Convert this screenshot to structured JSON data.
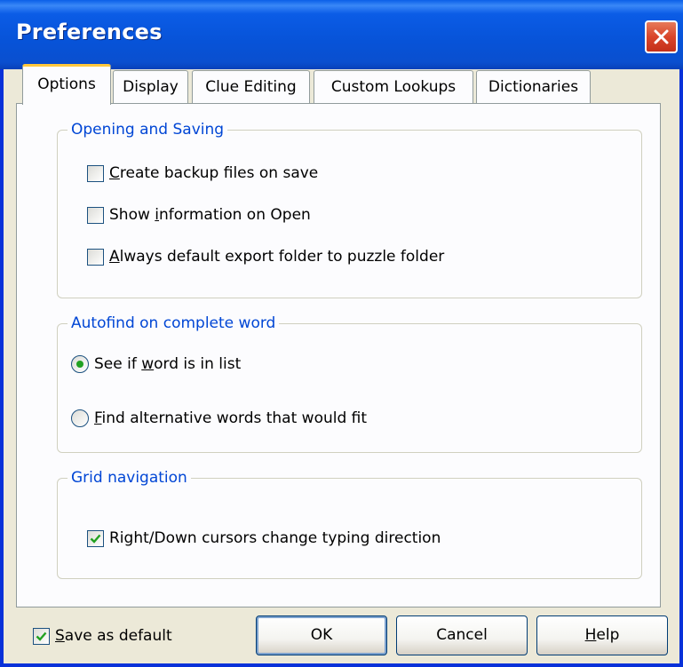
{
  "window": {
    "title": "Preferences",
    "close_label": "Close"
  },
  "tabs": [
    {
      "label": "Options",
      "active": true
    },
    {
      "label": "Display",
      "active": false
    },
    {
      "label": "Clue Editing",
      "active": false
    },
    {
      "label": "Custom Lookups",
      "active": false
    },
    {
      "label": "Dictionaries",
      "active": false
    }
  ],
  "groups": {
    "opening_saving": {
      "title": "Opening and Saving",
      "items": [
        {
          "pre": "",
          "key": "C",
          "post": "reate backup files on save",
          "checked": false
        },
        {
          "pre": "Show ",
          "key": "i",
          "post": "nformation on Open",
          "checked": false
        },
        {
          "pre": "",
          "key": "A",
          "post": "lways default export folder to puzzle folder",
          "checked": false
        }
      ]
    },
    "autofind": {
      "title": "Autofind on complete word",
      "items": [
        {
          "pre": "See if ",
          "key": "w",
          "post": "ord is in list",
          "selected": true
        },
        {
          "pre": "",
          "key": "F",
          "post": "ind alternative words that would fit",
          "selected": false
        }
      ]
    },
    "grid_navigation": {
      "title": "Grid navigation",
      "items": [
        {
          "pre": "Right/Down cursors change typing direction",
          "key": "",
          "post": "",
          "checked": true
        }
      ]
    }
  },
  "footer": {
    "save_default": {
      "pre": "",
      "key": "S",
      "post": "ave as default",
      "checked": true
    },
    "ok_label": "OK",
    "cancel_label": "Cancel",
    "help": {
      "pre": "",
      "key": "H",
      "post": "elp"
    }
  },
  "colors": {
    "titlebar": "#0753d8",
    "group_title": "#0046d5",
    "tab_highlight": "#ffc83c",
    "check_mark": "#21a121"
  }
}
